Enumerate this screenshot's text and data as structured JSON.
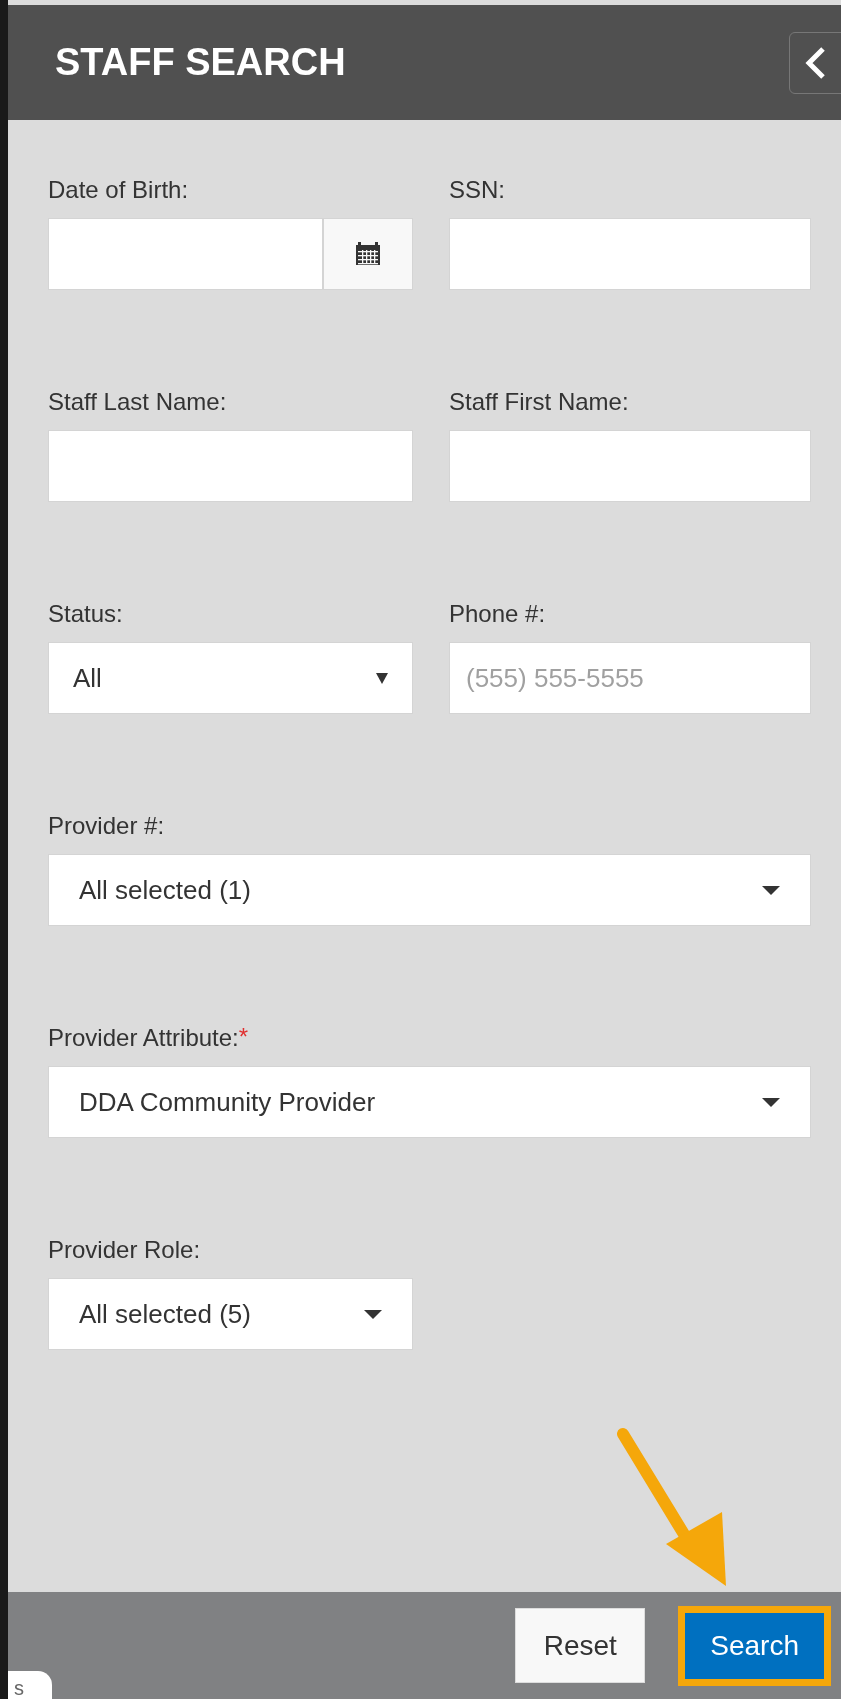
{
  "header": {
    "title": "STAFF SEARCH"
  },
  "fields": [
    {
      "kind": "date",
      "label": "Date of Birth:",
      "wide": false
    },
    {
      "kind": "text",
      "label": "SSN:",
      "wide": false
    },
    {
      "kind": "text",
      "label": "Staff Last Name:",
      "wide": false
    },
    {
      "kind": "text",
      "label": "Staff First Name:",
      "wide": false
    },
    {
      "kind": "select",
      "label": "Status:",
      "value": "All",
      "wide": false
    },
    {
      "kind": "text",
      "label": "Phone #:",
      "placeholder": "(555) 555-5555",
      "wide": false
    },
    {
      "kind": "multiselect",
      "label": "Provider #:",
      "value": "All selected (1)",
      "wide": true
    },
    {
      "kind": "multiselect",
      "label": "Provider Attribute:",
      "required_mark": "*",
      "value": "DDA Community Provider",
      "wide": true
    },
    {
      "kind": "multiselect",
      "label": "Provider Role:",
      "value": "All selected (5)",
      "wide": false
    }
  ],
  "buttons": [
    {
      "label": "Reset",
      "kind": "secondary",
      "highlighted": false
    },
    {
      "label": "Search",
      "kind": "primary",
      "highlighted": true
    }
  ],
  "corner_tab": {
    "text": "s"
  }
}
